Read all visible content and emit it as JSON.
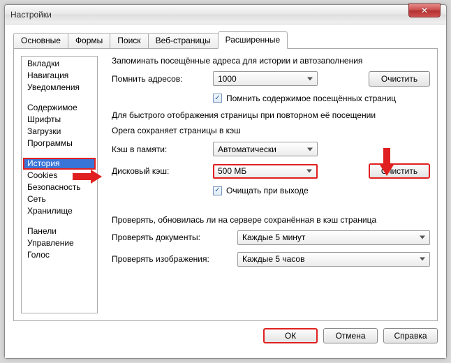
{
  "window": {
    "title": "Настройки"
  },
  "tabs": {
    "t0": "Основные",
    "t1": "Формы",
    "t2": "Поиск",
    "t3": "Веб-страницы",
    "t4": "Расширенные"
  },
  "sidebar": {
    "g1": {
      "i0": "Вкладки",
      "i1": "Навигация",
      "i2": "Уведомления"
    },
    "g2": {
      "i0": "Содержимое",
      "i1": "Шрифты",
      "i2": "Загрузки",
      "i3": "Программы"
    },
    "g3": {
      "i0": "История",
      "i1": "Cookies",
      "i2": "Безопасность",
      "i3": "Сеть",
      "i4": "Хранилище"
    },
    "g4": {
      "i0": "Панели",
      "i1": "Управление",
      "i2": "Голос"
    }
  },
  "pane": {
    "line1": "Запоминать посещённые адреса для истории и автозаполнения",
    "rememberLabel": "Помнить адресов:",
    "rememberValue": "1000",
    "clear1": "Очистить",
    "rememberContent": "Помнить содержимое посещённых страниц",
    "line2a": "Для быстрого отображения страницы при повторном её посещении",
    "line2b": "Opera сохраняет страницы в кэш",
    "memCacheLabel": "Кэш в памяти:",
    "memCacheValue": "Автоматически",
    "diskCacheLabel": "Дисковый кэш:",
    "diskCacheValue": "500 МБ",
    "clear2": "Очистить",
    "clearOnExit": "Очищать при выходе",
    "line3": "Проверять, обновилась ли на сервере сохранённая в кэш страница",
    "checkDocsLabel": "Проверять документы:",
    "checkDocsValue": "Каждые 5 минут",
    "checkImgsLabel": "Проверять изображения:",
    "checkImgsValue": "Каждые 5 часов"
  },
  "footer": {
    "ok": "ОК",
    "cancel": "Отмена",
    "help": "Справка"
  }
}
